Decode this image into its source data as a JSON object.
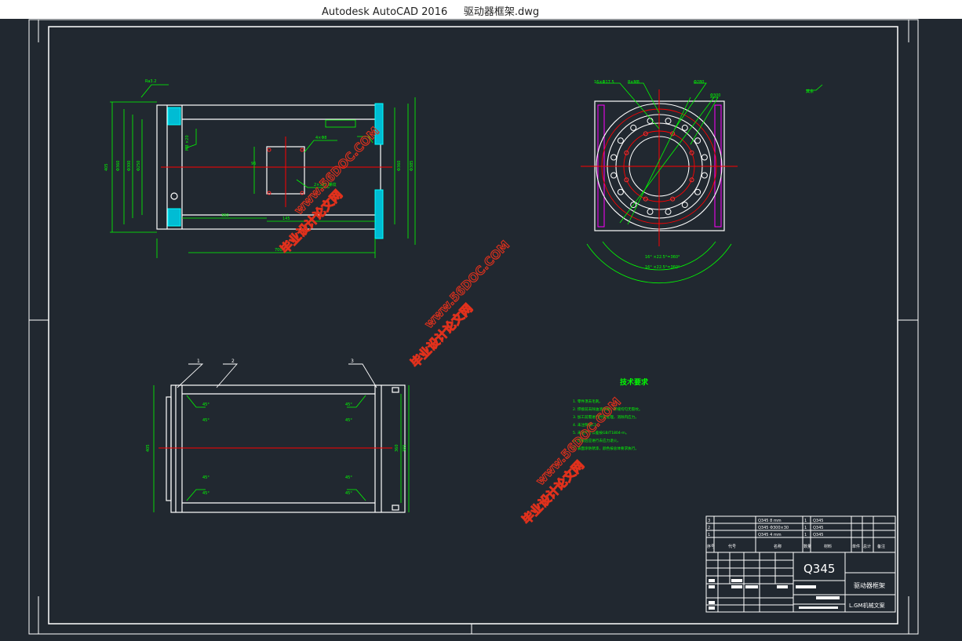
{
  "window": {
    "title": "Autodesk AutoCAD 2016     驱动器框架.dwg"
  },
  "watermarks": [
    {
      "line1": "www.56DOC.COM",
      "line2": "毕业设计论文网"
    },
    {
      "line1": "www.56DOC.COM",
      "line2": "毕业设计论文网"
    },
    {
      "line1": "www.56DOC.COM",
      "line2": "毕业设计论文网"
    }
  ],
  "drawing": {
    "tech_title": "技术要求",
    "tech_lines": [
      "1. 零件须去毛刺。",
      "2. 焊接前去除油渍锈蚀，焊缝均匀无裂纹。",
      "3. 加工前需进行时效处理，消除内应力。",
      "4. 未注倒角C1。",
      "5. 未注尺寸公差按GB/T1804-m。",
      "6. 焊接后应进行去应力退火。",
      "7. 表面涂防锈漆，颜色按总体要求执行。"
    ],
    "roughness_label": "其余",
    "part_labels": [
      "1",
      "2",
      "3"
    ],
    "material": "Q345",
    "part_name": "驱动器框架",
    "company": "L.GM机械文案",
    "bom_headers": [
      "序号",
      "代号",
      "名称",
      "数量",
      "材料",
      "单件",
      "总计",
      "备注"
    ],
    "bom_rows": [
      {
        "no": "3",
        "name": "Q345 8 mm",
        "qty": "1",
        "mat": "Q345"
      },
      {
        "no": "2",
        "name": "Q345 Φ300×30",
        "qty": "1",
        "mat": "Q345"
      },
      {
        "no": "1",
        "name": "Q345 4 mm",
        "qty": "1",
        "mat": "Q345"
      }
    ]
  },
  "colors": {
    "background": "#212830",
    "line": "#ffffff",
    "dimension": "#00ff00",
    "centerline": "#ff0000",
    "section": "#00ffff",
    "hidden": "#ff00ff",
    "watermark": "#e0311c"
  }
}
